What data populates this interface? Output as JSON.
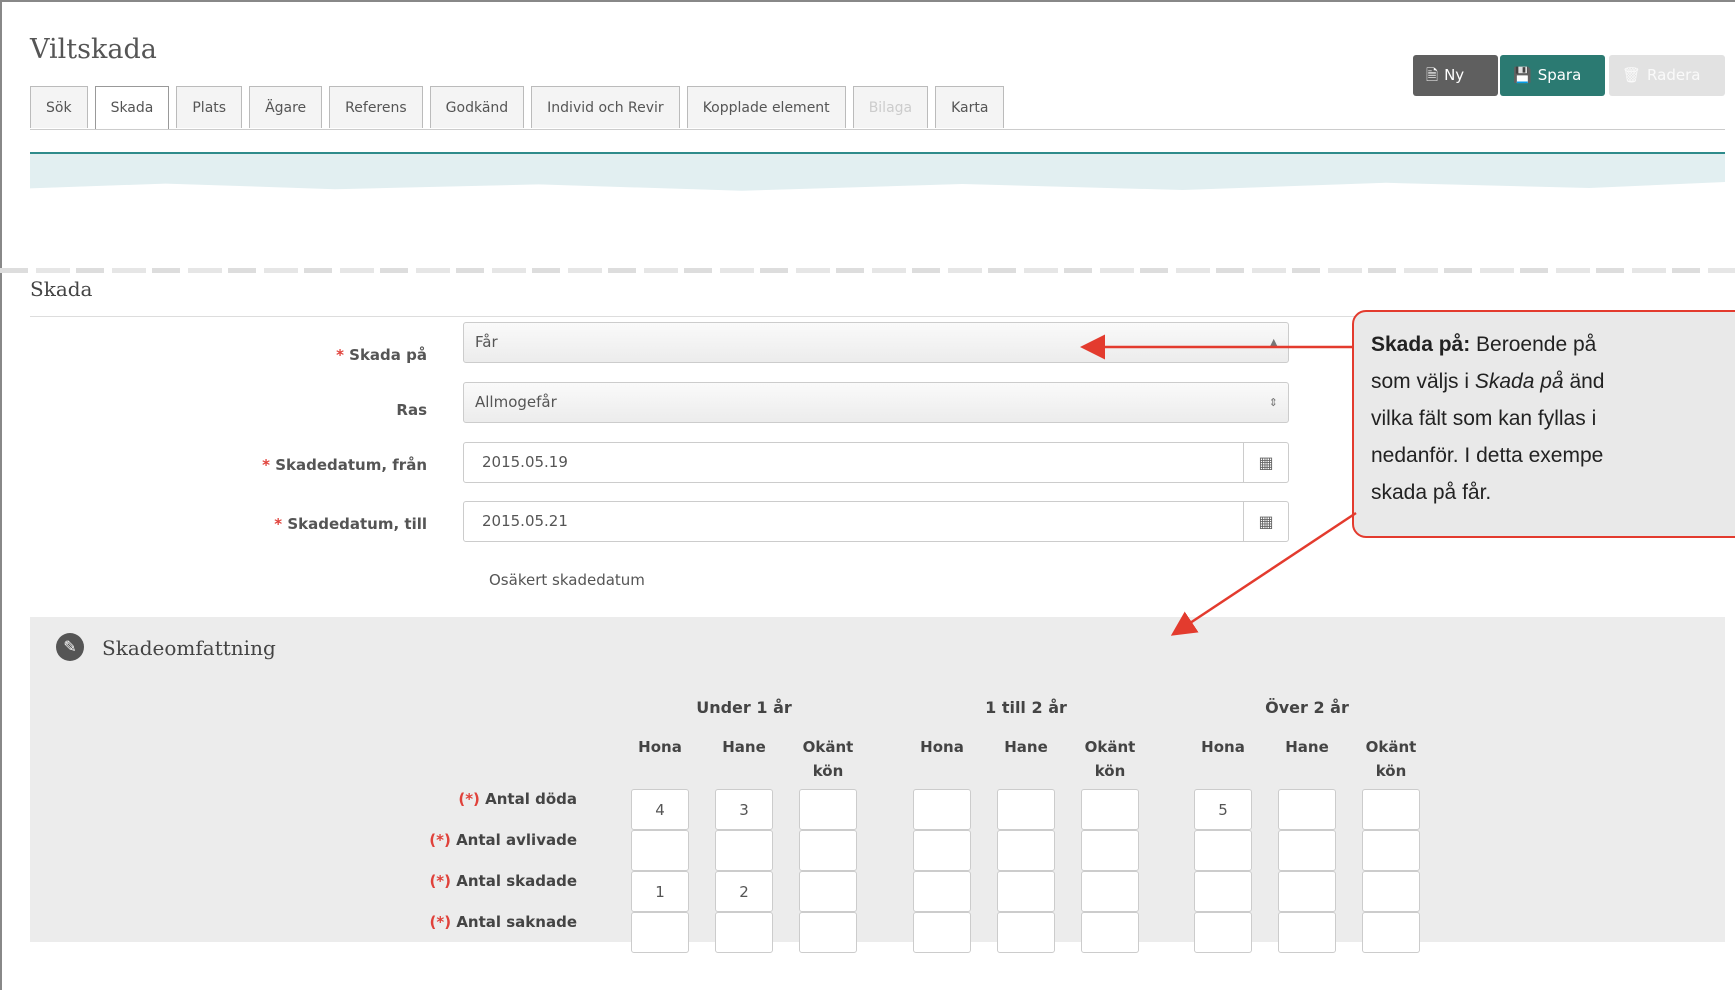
{
  "app": {
    "title": "Viltskada"
  },
  "toolbar": {
    "new_label": "Ny",
    "save_label": "Spara",
    "delete_label": "Radera",
    "save_color": "#2b7a72"
  },
  "tabs": [
    {
      "label": "Sök",
      "state": "normal"
    },
    {
      "label": "Skada",
      "state": "active"
    },
    {
      "label": "Plats",
      "state": "normal"
    },
    {
      "label": "Ägare",
      "state": "normal"
    },
    {
      "label": "Referens",
      "state": "normal"
    },
    {
      "label": "Godkänd",
      "state": "normal"
    },
    {
      "label": "Individ och Revir",
      "state": "normal"
    },
    {
      "label": "Kopplade element",
      "state": "normal"
    },
    {
      "label": "Bilaga",
      "state": "disabled"
    },
    {
      "label": "Karta",
      "state": "normal"
    }
  ],
  "skada": {
    "section_title": "Skada",
    "required_marker": "*",
    "skada_pa": {
      "label": "Skada på",
      "value": "Får"
    },
    "ras": {
      "label": "Ras",
      "value": "Allmogefår"
    },
    "datum_fran": {
      "label": "Skadedatum, från",
      "value": "2015.05.19"
    },
    "datum_till": {
      "label": "Skadedatum, till",
      "value": "2015.05.21"
    },
    "osakert_label": "Osäkert skadedatum"
  },
  "omfattning": {
    "title": "Skadeomfattning",
    "required_prefix": "(*)",
    "groups": [
      "Under 1 år",
      "1 till 2 år",
      "Över 2 år"
    ],
    "columns": [
      "Hona",
      "Hane",
      "Okänt kön"
    ],
    "rows": [
      {
        "label": "Antal döda",
        "values": [
          "4",
          "3",
          "",
          "",
          "",
          "",
          "5",
          "",
          ""
        ]
      },
      {
        "label": "Antal avlivade",
        "values": [
          "",
          "",
          "",
          "",
          "",
          "",
          "",
          "",
          ""
        ]
      },
      {
        "label": "Antal skadade",
        "values": [
          "1",
          "2",
          "",
          "",
          "",
          "",
          "",
          "",
          ""
        ]
      },
      {
        "label": "Antal saknade",
        "values": [
          "",
          "",
          "",
          "",
          "",
          "",
          "",
          "",
          ""
        ]
      }
    ]
  },
  "callout": {
    "heading": "Skada på:",
    "line1_rest": " Beroende på",
    "line2_pre": "som väljs i ",
    "line2_em": "Skada på",
    "line2_post": " änd",
    "line3": "vilka fält som kan fyllas i",
    "line4": "nedanför. I detta exempe",
    "line5": "skada på får.",
    "border_color": "#e33b2e"
  }
}
